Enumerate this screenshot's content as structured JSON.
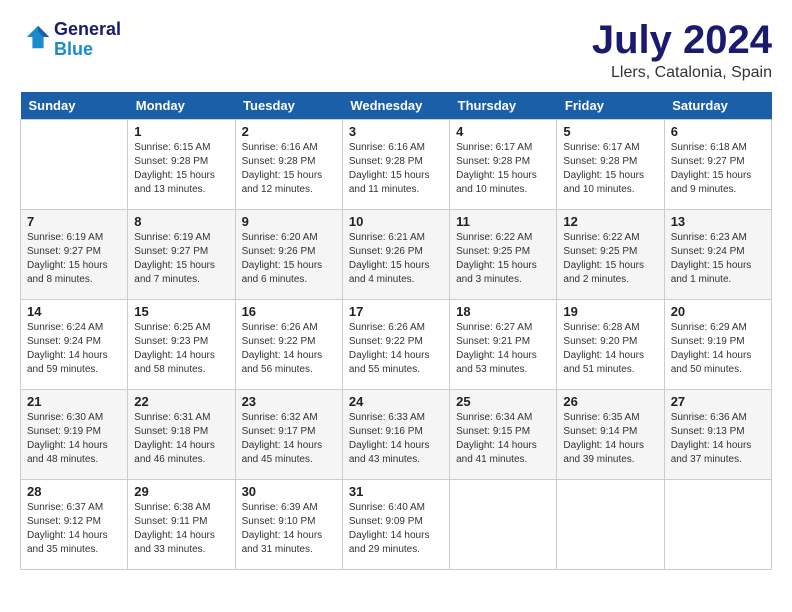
{
  "header": {
    "logo_line1": "General",
    "logo_line2": "Blue",
    "month_title": "July 2024",
    "location": "Llers, Catalonia, Spain"
  },
  "weekdays": [
    "Sunday",
    "Monday",
    "Tuesday",
    "Wednesday",
    "Thursday",
    "Friday",
    "Saturday"
  ],
  "weeks": [
    [
      {
        "day": "",
        "sunrise": "",
        "sunset": "",
        "daylight": ""
      },
      {
        "day": "1",
        "sunrise": "Sunrise: 6:15 AM",
        "sunset": "Sunset: 9:28 PM",
        "daylight": "Daylight: 15 hours and 13 minutes."
      },
      {
        "day": "2",
        "sunrise": "Sunrise: 6:16 AM",
        "sunset": "Sunset: 9:28 PM",
        "daylight": "Daylight: 15 hours and 12 minutes."
      },
      {
        "day": "3",
        "sunrise": "Sunrise: 6:16 AM",
        "sunset": "Sunset: 9:28 PM",
        "daylight": "Daylight: 15 hours and 11 minutes."
      },
      {
        "day": "4",
        "sunrise": "Sunrise: 6:17 AM",
        "sunset": "Sunset: 9:28 PM",
        "daylight": "Daylight: 15 hours and 10 minutes."
      },
      {
        "day": "5",
        "sunrise": "Sunrise: 6:17 AM",
        "sunset": "Sunset: 9:28 PM",
        "daylight": "Daylight: 15 hours and 10 minutes."
      },
      {
        "day": "6",
        "sunrise": "Sunrise: 6:18 AM",
        "sunset": "Sunset: 9:27 PM",
        "daylight": "Daylight: 15 hours and 9 minutes."
      }
    ],
    [
      {
        "day": "7",
        "sunrise": "Sunrise: 6:19 AM",
        "sunset": "Sunset: 9:27 PM",
        "daylight": "Daylight: 15 hours and 8 minutes."
      },
      {
        "day": "8",
        "sunrise": "Sunrise: 6:19 AM",
        "sunset": "Sunset: 9:27 PM",
        "daylight": "Daylight: 15 hours and 7 minutes."
      },
      {
        "day": "9",
        "sunrise": "Sunrise: 6:20 AM",
        "sunset": "Sunset: 9:26 PM",
        "daylight": "Daylight: 15 hours and 6 minutes."
      },
      {
        "day": "10",
        "sunrise": "Sunrise: 6:21 AM",
        "sunset": "Sunset: 9:26 PM",
        "daylight": "Daylight: 15 hours and 4 minutes."
      },
      {
        "day": "11",
        "sunrise": "Sunrise: 6:22 AM",
        "sunset": "Sunset: 9:25 PM",
        "daylight": "Daylight: 15 hours and 3 minutes."
      },
      {
        "day": "12",
        "sunrise": "Sunrise: 6:22 AM",
        "sunset": "Sunset: 9:25 PM",
        "daylight": "Daylight: 15 hours and 2 minutes."
      },
      {
        "day": "13",
        "sunrise": "Sunrise: 6:23 AM",
        "sunset": "Sunset: 9:24 PM",
        "daylight": "Daylight: 15 hours and 1 minute."
      }
    ],
    [
      {
        "day": "14",
        "sunrise": "Sunrise: 6:24 AM",
        "sunset": "Sunset: 9:24 PM",
        "daylight": "Daylight: 14 hours and 59 minutes."
      },
      {
        "day": "15",
        "sunrise": "Sunrise: 6:25 AM",
        "sunset": "Sunset: 9:23 PM",
        "daylight": "Daylight: 14 hours and 58 minutes."
      },
      {
        "day": "16",
        "sunrise": "Sunrise: 6:26 AM",
        "sunset": "Sunset: 9:22 PM",
        "daylight": "Daylight: 14 hours and 56 minutes."
      },
      {
        "day": "17",
        "sunrise": "Sunrise: 6:26 AM",
        "sunset": "Sunset: 9:22 PM",
        "daylight": "Daylight: 14 hours and 55 minutes."
      },
      {
        "day": "18",
        "sunrise": "Sunrise: 6:27 AM",
        "sunset": "Sunset: 9:21 PM",
        "daylight": "Daylight: 14 hours and 53 minutes."
      },
      {
        "day": "19",
        "sunrise": "Sunrise: 6:28 AM",
        "sunset": "Sunset: 9:20 PM",
        "daylight": "Daylight: 14 hours and 51 minutes."
      },
      {
        "day": "20",
        "sunrise": "Sunrise: 6:29 AM",
        "sunset": "Sunset: 9:19 PM",
        "daylight": "Daylight: 14 hours and 50 minutes."
      }
    ],
    [
      {
        "day": "21",
        "sunrise": "Sunrise: 6:30 AM",
        "sunset": "Sunset: 9:19 PM",
        "daylight": "Daylight: 14 hours and 48 minutes."
      },
      {
        "day": "22",
        "sunrise": "Sunrise: 6:31 AM",
        "sunset": "Sunset: 9:18 PM",
        "daylight": "Daylight: 14 hours and 46 minutes."
      },
      {
        "day": "23",
        "sunrise": "Sunrise: 6:32 AM",
        "sunset": "Sunset: 9:17 PM",
        "daylight": "Daylight: 14 hours and 45 minutes."
      },
      {
        "day": "24",
        "sunrise": "Sunrise: 6:33 AM",
        "sunset": "Sunset: 9:16 PM",
        "daylight": "Daylight: 14 hours and 43 minutes."
      },
      {
        "day": "25",
        "sunrise": "Sunrise: 6:34 AM",
        "sunset": "Sunset: 9:15 PM",
        "daylight": "Daylight: 14 hours and 41 minutes."
      },
      {
        "day": "26",
        "sunrise": "Sunrise: 6:35 AM",
        "sunset": "Sunset: 9:14 PM",
        "daylight": "Daylight: 14 hours and 39 minutes."
      },
      {
        "day": "27",
        "sunrise": "Sunrise: 6:36 AM",
        "sunset": "Sunset: 9:13 PM",
        "daylight": "Daylight: 14 hours and 37 minutes."
      }
    ],
    [
      {
        "day": "28",
        "sunrise": "Sunrise: 6:37 AM",
        "sunset": "Sunset: 9:12 PM",
        "daylight": "Daylight: 14 hours and 35 minutes."
      },
      {
        "day": "29",
        "sunrise": "Sunrise: 6:38 AM",
        "sunset": "Sunset: 9:11 PM",
        "daylight": "Daylight: 14 hours and 33 minutes."
      },
      {
        "day": "30",
        "sunrise": "Sunrise: 6:39 AM",
        "sunset": "Sunset: 9:10 PM",
        "daylight": "Daylight: 14 hours and 31 minutes."
      },
      {
        "day": "31",
        "sunrise": "Sunrise: 6:40 AM",
        "sunset": "Sunset: 9:09 PM",
        "daylight": "Daylight: 14 hours and 29 minutes."
      },
      {
        "day": "",
        "sunrise": "",
        "sunset": "",
        "daylight": ""
      },
      {
        "day": "",
        "sunrise": "",
        "sunset": "",
        "daylight": ""
      },
      {
        "day": "",
        "sunrise": "",
        "sunset": "",
        "daylight": ""
      }
    ]
  ]
}
